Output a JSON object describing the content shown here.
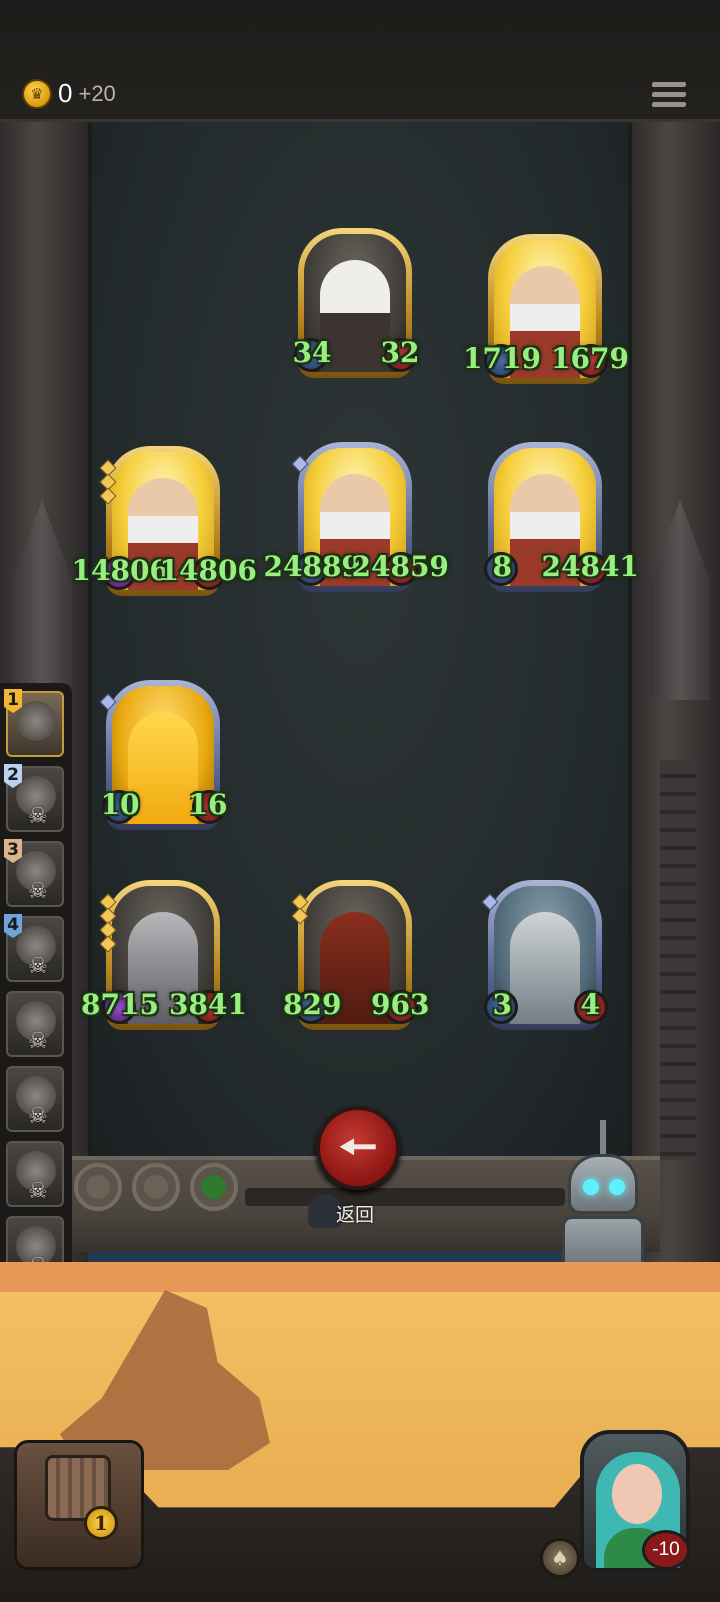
{
  "top_bar": {
    "gold_amount": "0",
    "gold_income": "+20",
    "gold_icon": "crown-coin-icon",
    "menu_icon": "hamburger-menu-icon"
  },
  "board": {
    "minions": [
      {
        "id": "rat",
        "frame": "gold",
        "art": "dark",
        "attack": "34",
        "health": "32"
      },
      {
        "id": "dwarf-1",
        "frame": "gold",
        "art": "yellow",
        "attack": "1719",
        "health": "1679"
      },
      {
        "id": "dwarf-2",
        "frame": "gold",
        "art": "yellow",
        "attack": "14806",
        "health": "14806"
      },
      {
        "id": "dwarf-3",
        "frame": "blue",
        "art": "yellow",
        "attack": "24889",
        "health": "24859"
      },
      {
        "id": "dwarf-4",
        "frame": "blue",
        "art": "yellow",
        "attack": "8",
        "health": "24841"
      },
      {
        "id": "golden-dragon",
        "frame": "blue",
        "art": "gold",
        "attack": "10",
        "health": "16"
      },
      {
        "id": "grey-beast",
        "frame": "gold",
        "art": "dark",
        "attack": "8715",
        "health": "3841"
      },
      {
        "id": "red-dragon",
        "frame": "gold",
        "art": "dark",
        "attack": "829",
        "health": "963"
      },
      {
        "id": "moth-demon",
        "frame": "blue",
        "art": "slate",
        "attack": "3",
        "health": "4"
      }
    ]
  },
  "back_button": {
    "label": "返回",
    "icon": "arrow-left-icon"
  },
  "opponents": [
    {
      "rank": "1",
      "active": true
    },
    {
      "rank": "2",
      "active": false
    },
    {
      "rank": "3",
      "active": false
    },
    {
      "rank": "4",
      "active": false
    },
    {
      "rank": "",
      "active": false
    },
    {
      "rank": "",
      "active": false
    },
    {
      "rank": "",
      "active": false
    },
    {
      "rank": "",
      "active": false
    }
  ],
  "bottom": {
    "chest_count": "1",
    "hero_health": "-10",
    "hero_power_icon": "acorn-icon"
  },
  "colors": {
    "stat_text": "#98ee7f",
    "back_button": "#b02723",
    "gold_frame": "#d4a93a",
    "blue_frame": "#6b77a3"
  }
}
